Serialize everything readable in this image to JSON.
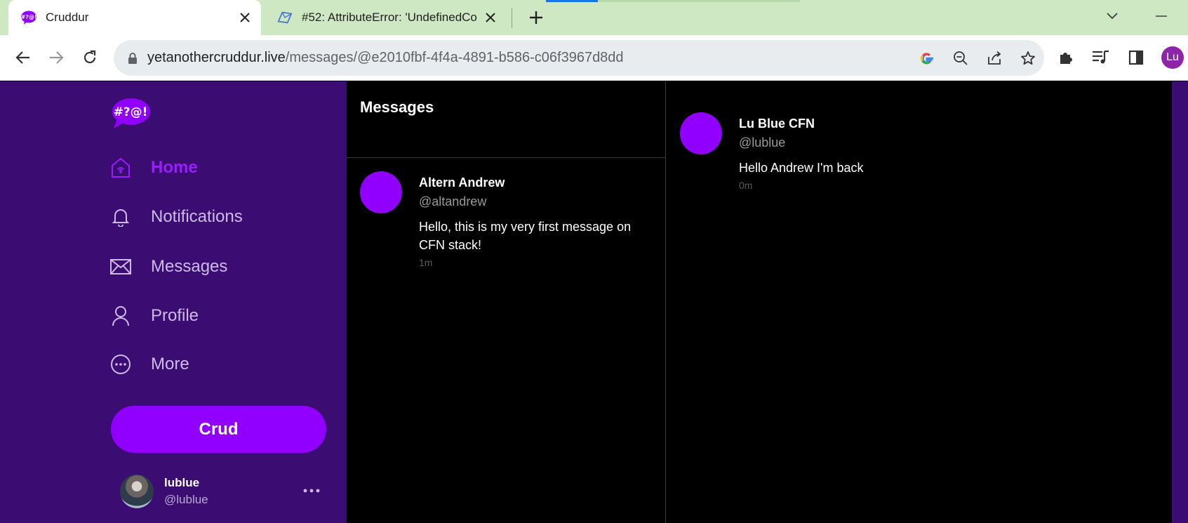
{
  "browser": {
    "tabs": [
      {
        "title": "Cruddur",
        "active": true
      },
      {
        "title": "#52: AttributeError: 'UndefinedCo",
        "active": false
      }
    ],
    "url_host": "yetanothercruddur.live",
    "url_path": "/messages/@e2010fbf-4f4a-4891-b586-c06f3967d8dd",
    "profile_initials": "Lu"
  },
  "sidebar": {
    "logo_text": "#?@!",
    "items": [
      {
        "label": "Home",
        "icon": "home-icon",
        "active": true
      },
      {
        "label": "Notifications",
        "icon": "bell-icon",
        "active": false
      },
      {
        "label": "Messages",
        "icon": "envelope-icon",
        "active": false
      },
      {
        "label": "Profile",
        "icon": "person-icon",
        "active": false
      },
      {
        "label": "More",
        "icon": "more-circle-icon",
        "active": false
      }
    ],
    "crud_button": "Crud",
    "user": {
      "name": "lublue",
      "handle": "@lublue"
    }
  },
  "messages": {
    "title": "Messages",
    "groups": [
      {
        "name": "Altern Andrew",
        "handle": "@altandrew",
        "text": "Hello, this is my very first message on CFN stack!",
        "time": "1m"
      }
    ]
  },
  "thread": {
    "messages": [
      {
        "name": "Lu Blue CFN",
        "handle": "@lublue",
        "text": "Hello Andrew I'm back",
        "time": "0m"
      }
    ]
  },
  "colors": {
    "sidebar_bg": "#3b0d73",
    "accent": "#9100ff",
    "tabstrip": "#cfe8c4"
  }
}
